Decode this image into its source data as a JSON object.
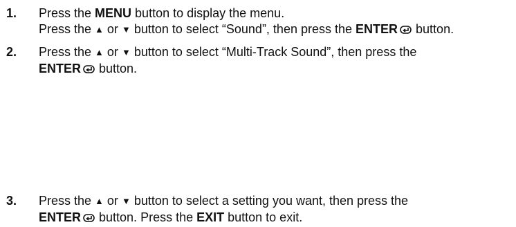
{
  "steps": [
    {
      "number": "1.",
      "lines": [
        {
          "pre": "Press the ",
          "bold": "MENU",
          "post": " button to display the menu."
        },
        {
          "pre": "Press the ",
          "up": "▲",
          "or": " or ",
          "down": "▼",
          "mid": " button to select “Sound”, then press the ",
          "bold": "ENTER",
          "post": " button."
        }
      ]
    },
    {
      "number": "2.",
      "lines": [
        {
          "pre": "Press the ",
          "up": "▲",
          "or": " or ",
          "down": "▼",
          "post": " button to select “Multi-Track Sound”, then press the"
        },
        {
          "bold": "ENTER",
          "post": " button."
        }
      ]
    },
    {
      "number": "3.",
      "lines": [
        {
          "pre": "Press the ",
          "up": "▲",
          "or": " or ",
          "down": "▼",
          "post": " button to select a setting you want, then press the"
        },
        {
          "bold": "ENTER",
          "mid": " button. Press the ",
          "bold2": "EXIT",
          "post": " button to exit."
        }
      ]
    }
  ],
  "icons": {
    "enter": "enter-icon",
    "up": "up-arrow-icon",
    "down": "down-arrow-icon"
  }
}
